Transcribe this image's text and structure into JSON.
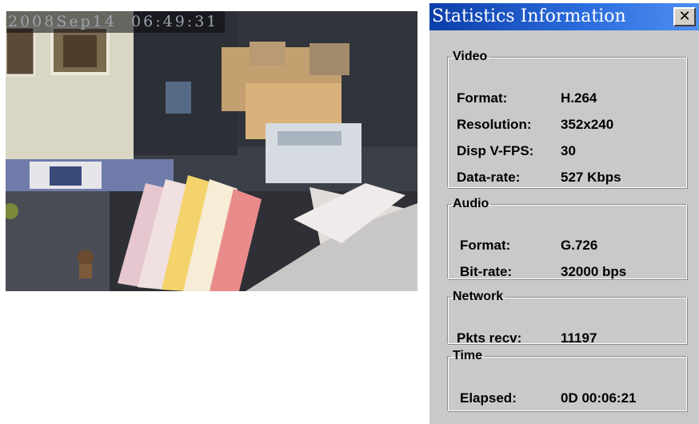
{
  "video": {
    "osd_timestamp": "2008Sep14  06:49:31"
  },
  "dialog": {
    "title": "Statistics Information",
    "close_label": "✕",
    "groups": {
      "video": {
        "legend": "Video",
        "rows": [
          {
            "label": "Format:",
            "value": "H.264"
          },
          {
            "label": "Resolution:",
            "value": "352x240"
          },
          {
            "label": "Disp V-FPS:",
            "value": "30"
          },
          {
            "label": "Data-rate:",
            "value": "527 Kbps"
          }
        ]
      },
      "audio": {
        "legend": "Audio",
        "rows": [
          {
            "label": "Format:",
            "value": "G.726"
          },
          {
            "label": "Bit-rate:",
            "value": "32000 bps"
          }
        ]
      },
      "network": {
        "legend": "Network",
        "rows": [
          {
            "label": "Pkts recv:",
            "value": "11197"
          }
        ]
      },
      "time": {
        "legend": "Time",
        "rows": [
          {
            "label": "Elapsed:",
            "value": "0D 00:06:21"
          }
        ]
      }
    }
  },
  "colors": {
    "titlebar_start": "#0b3ea8",
    "titlebar_end": "#4f8ff0",
    "dialog_bg": "#c9c9c9"
  }
}
